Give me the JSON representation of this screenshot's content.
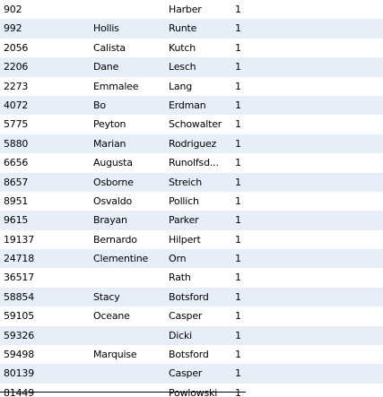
{
  "table": {
    "rows": [
      {
        "id": "902",
        "first_name": "",
        "last_name": "Harber",
        "flag": "1"
      },
      {
        "id": "992",
        "first_name": "Hollis",
        "last_name": "Runte",
        "flag": "1"
      },
      {
        "id": "2056",
        "first_name": "Calista",
        "last_name": "Kutch",
        "flag": "1"
      },
      {
        "id": "2206",
        "first_name": "Dane",
        "last_name": "Lesch",
        "flag": "1"
      },
      {
        "id": "2273",
        "first_name": "Emmalee",
        "last_name": "Lang",
        "flag": "1"
      },
      {
        "id": "4072",
        "first_name": "Bo",
        "last_name": "Erdman",
        "flag": "1"
      },
      {
        "id": "5775",
        "first_name": "Peyton",
        "last_name": "Schowalter",
        "flag": "1"
      },
      {
        "id": "5880",
        "first_name": "Marian",
        "last_name": "Rodriguez",
        "flag": "1"
      },
      {
        "id": "6656",
        "first_name": "Augusta",
        "last_name": "Runolfsd...",
        "flag": "1"
      },
      {
        "id": "8657",
        "first_name": "Osborne",
        "last_name": "Streich",
        "flag": "1"
      },
      {
        "id": "8951",
        "first_name": "Osvaldo",
        "last_name": "Pollich",
        "flag": "1"
      },
      {
        "id": "9615",
        "first_name": "Brayan",
        "last_name": "Parker",
        "flag": "1"
      },
      {
        "id": "19137",
        "first_name": "Bernardo",
        "last_name": "Hilpert",
        "flag": "1"
      },
      {
        "id": "24718",
        "first_name": "Clementine",
        "last_name": "Orn",
        "flag": "1"
      },
      {
        "id": "36517",
        "first_name": "",
        "last_name": "Rath",
        "flag": "1"
      },
      {
        "id": "58854",
        "first_name": "Stacy",
        "last_name": "Botsford",
        "flag": "1"
      },
      {
        "id": "59105",
        "first_name": "Oceane",
        "last_name": "Casper",
        "flag": "1"
      },
      {
        "id": "59326",
        "first_name": "",
        "last_name": "Dicki",
        "flag": "1"
      },
      {
        "id": "59498",
        "first_name": "Marquise",
        "last_name": "Botsford",
        "flag": "1"
      },
      {
        "id": "80139",
        "first_name": "",
        "last_name": "Casper",
        "flag": "1"
      },
      {
        "id": "81449",
        "first_name": "",
        "last_name": "Powlowski",
        "flag": "1"
      }
    ]
  }
}
